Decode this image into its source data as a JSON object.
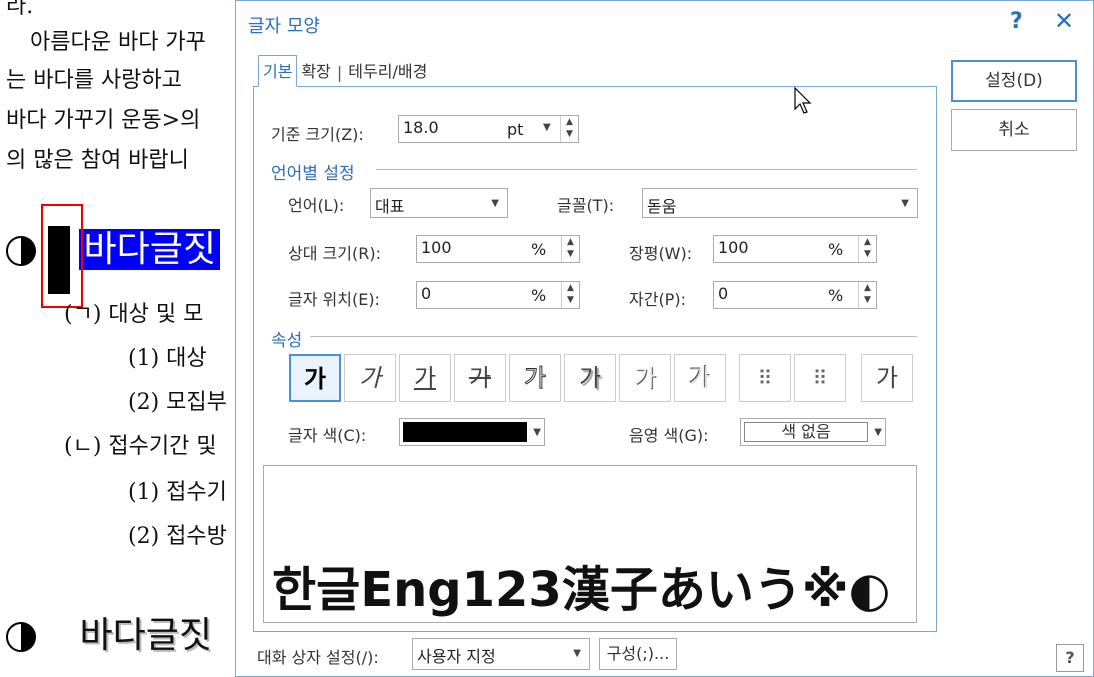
{
  "document": {
    "line_top": "라.",
    "para1": "아름다운 바다 가꾸",
    "para2": "는 바다를 사랑하고",
    "para3": "바다 가꾸기 운동>의",
    "para4": "의 많은 참여 바랍니",
    "heading1_text": "바다글짓",
    "sub1": "(ㄱ) 대상 및 모",
    "sub1_1": "(1) 대상",
    "sub1_2": "(2) 모집부",
    "sub2": "(ㄴ) 접수기간 및",
    "sub2_1": "(1) 접수기",
    "sub2_2": "(2) 접수방",
    "heading2_text": "바다글짓"
  },
  "dialog": {
    "title": "글자 모양",
    "help_icon_label": "?",
    "close_icon_label": "✕",
    "tabs": [
      "기본",
      "확장",
      "테두리/배경"
    ],
    "tab_separator": "|",
    "base_size": {
      "label": "기준 크기(Z):",
      "value": "18.0",
      "unit": "pt"
    },
    "lang_section": "언어별 설정",
    "language": {
      "label": "언어(L):",
      "value": "대표"
    },
    "font": {
      "label": "글꼴(T):",
      "value": "돋움"
    },
    "relative_size": {
      "label": "상대 크기(R):",
      "value": "100",
      "unit": "%"
    },
    "width_ratio": {
      "label": "장평(W):",
      "value": "100",
      "unit": "%"
    },
    "char_position": {
      "label": "글자 위치(E):",
      "value": "0",
      "unit": "%"
    },
    "spacing": {
      "label": "자간(P):",
      "value": "0",
      "unit": "%"
    },
    "attr_section": "속성",
    "attr_buttons": [
      {
        "name": "bold-button",
        "glyph": "가"
      },
      {
        "name": "italic-button",
        "glyph": "가"
      },
      {
        "name": "underline-button",
        "glyph": "가"
      },
      {
        "name": "strikethrough-button",
        "glyph": "가"
      },
      {
        "name": "outline-button",
        "glyph": "가"
      },
      {
        "name": "shadow-button",
        "glyph": "가"
      },
      {
        "name": "emboss-button",
        "glyph": "가"
      },
      {
        "name": "engrave-button",
        "glyph": "가"
      },
      {
        "name": "superscript-button",
        "glyph": "⠿"
      },
      {
        "name": "subscript-button",
        "glyph": "⠿"
      },
      {
        "name": "normal-button",
        "glyph": "가"
      }
    ],
    "text_color": {
      "label": "글자 색(C):",
      "color": "#000000"
    },
    "shade_color": {
      "label": "음영 색(G):",
      "value": "색 없음"
    },
    "preview_text": "한글Eng123漢子あいう※◐",
    "ok_button": "설정(D)",
    "cancel_button": "취소",
    "dialog_setting_label": "대화 상자 설정(/):",
    "dialog_setting_value": "사용자 지정",
    "config_button": "구성(;)...",
    "bottom_help": "?"
  },
  "colors": {
    "accent": "#2b6fb8",
    "selection": "#0000ff",
    "focus_border": "#4a90d9",
    "marker": "#e00000"
  }
}
